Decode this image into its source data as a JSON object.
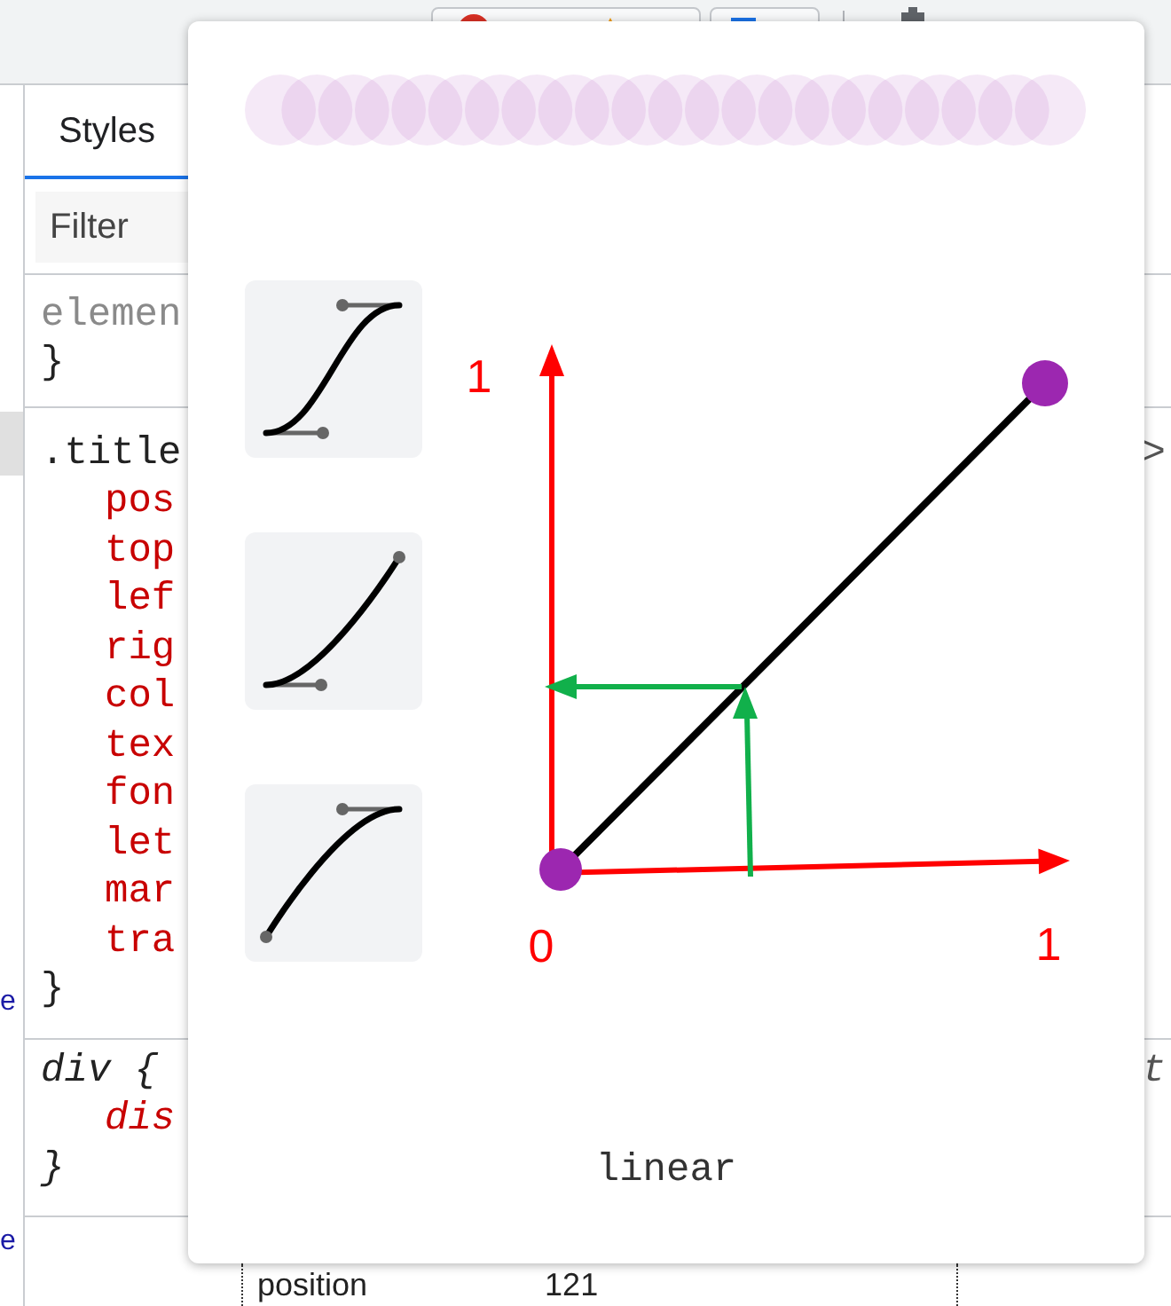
{
  "elements_pane": {
    "rows": [
      {
        "selected": true
      },
      {
        "text": "e",
        "selected": false
      },
      {
        "text": "e",
        "selected": false
      }
    ]
  },
  "styles_pane": {
    "tabs": [
      {
        "label": "Styles",
        "selected": true
      }
    ],
    "filter": {
      "placeholder": "Filter"
    },
    "rules": [
      {
        "kind": "inline",
        "selector": "elemen",
        "closing": "}"
      },
      {
        "kind": "author",
        "selector": ".title",
        "source": ">",
        "properties": [
          "pos",
          "top",
          "lef",
          "rig",
          "col",
          "tex",
          "fon",
          "let",
          "mar",
          "tra"
        ],
        "closing": "}"
      },
      {
        "kind": "user-agent",
        "selector": "div {",
        "source": "t",
        "properties": [
          "dis"
        ],
        "closing": "}"
      }
    ],
    "box_model": {
      "label": "position",
      "value": "121"
    }
  },
  "easing_popup": {
    "presets": [
      {
        "kind": "ease-in-out"
      },
      {
        "kind": "ease-in"
      },
      {
        "kind": "ease-out"
      }
    ],
    "graph": {
      "y_max_label": "1",
      "origin_label": "0",
      "x_max_label": "1"
    },
    "easing_name": "linear"
  }
}
